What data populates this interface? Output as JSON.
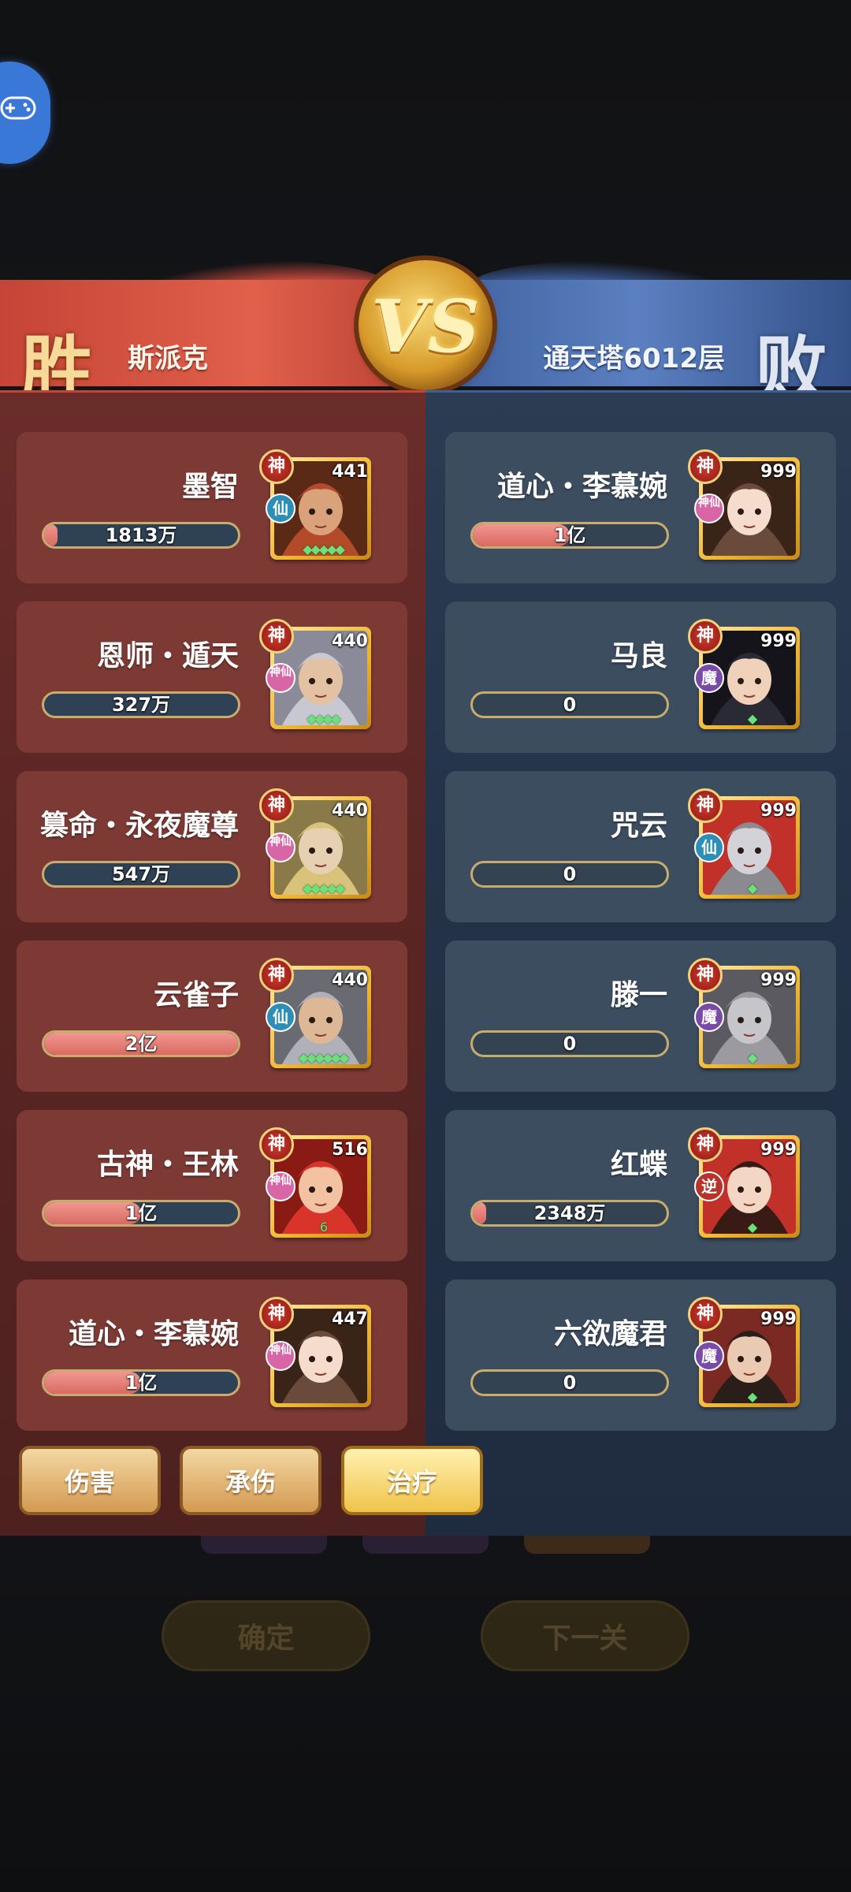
{
  "banner": {
    "win_label": "胜",
    "lose_label": "败",
    "vs_label": "VS",
    "left_player": "斯派克",
    "right_player": "通天塔6012层"
  },
  "left_team": [
    {
      "name": "墨智",
      "damage": "1813万",
      "fill_pct": 7,
      "level": "441",
      "race": "仙",
      "race_class": "xian",
      "god": "神",
      "stars": "◆◆◆◆◆",
      "portrait_icon": "old-warrior-portrait"
    },
    {
      "name": "恩师・遁天",
      "damage": "327万",
      "fill_pct": 0,
      "level": "440",
      "race": "神仙",
      "race_class": "shen",
      "god": "神",
      "stars": "◆◆◆◆",
      "portrait_icon": "white-haired-elder-portrait"
    },
    {
      "name": "篡命・永夜魔尊",
      "damage": "547万",
      "fill_pct": 0,
      "level": "440",
      "race": "神仙",
      "race_class": "shen",
      "god": "神",
      "stars": "◆◆◆◆◆",
      "portrait_icon": "golden-demon-lord-portrait"
    },
    {
      "name": "云雀子",
      "damage": "2亿",
      "fill_pct": 100,
      "level": "440",
      "race": "仙",
      "race_class": "xian",
      "god": "神",
      "stars": "◆◆◆◆◆◆",
      "portrait_icon": "bald-elder-portrait"
    },
    {
      "name": "古神・王林",
      "damage": "1亿",
      "fill_pct": 50,
      "level": "516",
      "race": "神仙",
      "race_class": "shen",
      "god": "神",
      "stars": "6",
      "portrait_icon": "red-haired-god-portrait"
    },
    {
      "name": "道心・李慕婉",
      "damage": "1亿",
      "fill_pct": 50,
      "level": "447",
      "race": "神仙",
      "race_class": "shen",
      "god": "神",
      "stars": "",
      "portrait_icon": "maiden-portrait"
    }
  ],
  "right_team": [
    {
      "name": "道心・李慕婉",
      "damage": "1亿",
      "fill_pct": 50,
      "level": "999",
      "race": "神仙",
      "race_class": "shen",
      "god": "神",
      "stars": "",
      "portrait_icon": "maiden-portrait"
    },
    {
      "name": "马良",
      "damage": "0",
      "fill_pct": 0,
      "level": "999",
      "race": "魔",
      "race_class": "mo",
      "god": "神",
      "stars": "◆",
      "portrait_icon": "dark-haired-youth-portrait"
    },
    {
      "name": "咒云",
      "damage": "0",
      "fill_pct": 0,
      "level": "999",
      "race": "仙",
      "race_class": "xian",
      "god": "神",
      "stars": "◆",
      "portrait_icon": "masked-demon-portrait"
    },
    {
      "name": "滕一",
      "damage": "0",
      "fill_pct": 0,
      "level": "999",
      "race": "魔",
      "race_class": "mo",
      "god": "神",
      "stars": "◆",
      "portrait_icon": "grey-ghoul-portrait"
    },
    {
      "name": "红蝶",
      "damage": "2348万",
      "fill_pct": 7,
      "level": "999",
      "race": "逆",
      "race_class": "ni",
      "god": "神",
      "stars": "◆",
      "portrait_icon": "red-butterfly-maiden-portrait"
    },
    {
      "name": "六欲魔君",
      "damage": "0",
      "fill_pct": 0,
      "level": "999",
      "race": "魔",
      "race_class": "mo",
      "god": "神",
      "stars": "◆",
      "portrait_icon": "demon-lord-portrait"
    }
  ],
  "tabs": [
    {
      "label": "伤害",
      "active": false
    },
    {
      "label": "承伤",
      "active": false
    },
    {
      "label": "治疗",
      "active": true
    }
  ],
  "background": {
    "confirm_label": "确定",
    "next_label": "下一关"
  },
  "colors": {
    "win_red": "#c64437",
    "lose_blue": "#3e5f9c",
    "bar_fill": "#e07870",
    "gold": "#f0c34a"
  }
}
